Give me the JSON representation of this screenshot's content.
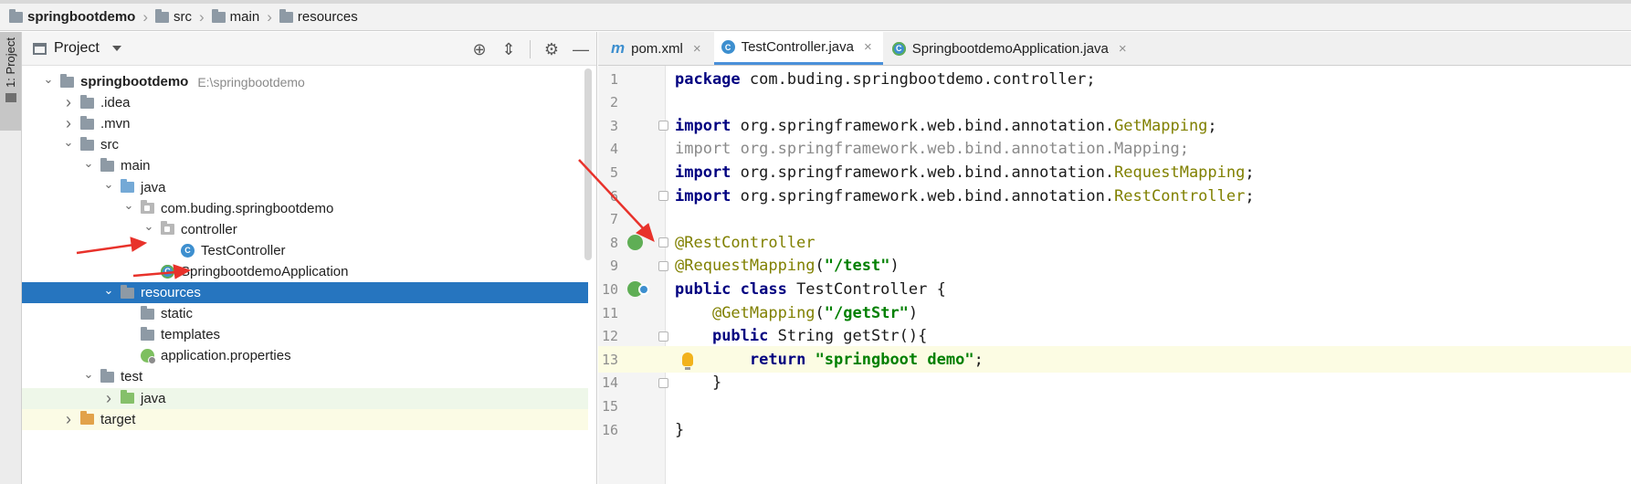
{
  "breadcrumb": {
    "items": [
      {
        "label": "springbootdemo",
        "icon": "folder-icon"
      },
      {
        "label": "src",
        "icon": "folder-icon"
      },
      {
        "label": "main",
        "icon": "folder-icon"
      },
      {
        "label": "resources",
        "icon": "resources-folder-icon"
      }
    ]
  },
  "sidebar": {
    "project_tab_label": "1: Project"
  },
  "project_panel": {
    "title": "Project",
    "tools": [
      "locate-icon",
      "collapse-icon",
      "gear-icon",
      "minimize-icon"
    ],
    "tree": [
      {
        "label": "springbootdemo",
        "path": "E:\\springbootdemo",
        "depth": 0,
        "expanded": true,
        "icon": "module-folder",
        "bold": true
      },
      {
        "label": ".idea",
        "depth": 1,
        "expanded": false,
        "icon": "folder"
      },
      {
        "label": ".mvn",
        "depth": 1,
        "expanded": false,
        "icon": "folder"
      },
      {
        "label": "src",
        "depth": 1,
        "expanded": true,
        "icon": "folder"
      },
      {
        "label": "main",
        "depth": 2,
        "expanded": true,
        "icon": "folder"
      },
      {
        "label": "java",
        "depth": 3,
        "expanded": true,
        "icon": "source-folder"
      },
      {
        "label": "com.buding.springbootdemo",
        "depth": 4,
        "expanded": true,
        "icon": "package"
      },
      {
        "label": "controller",
        "depth": 5,
        "expanded": true,
        "icon": "package"
      },
      {
        "label": "TestController",
        "depth": 6,
        "icon": "class"
      },
      {
        "label": "SpringbootdemoApplication",
        "depth": 5,
        "icon": "app-class"
      },
      {
        "label": "resources",
        "depth": 3,
        "expanded": true,
        "icon": "resources-folder",
        "selected": true
      },
      {
        "label": "static",
        "depth": 4,
        "icon": "folder"
      },
      {
        "label": "templates",
        "depth": 4,
        "icon": "folder"
      },
      {
        "label": "application.properties",
        "depth": 4,
        "icon": "properties"
      },
      {
        "label": "test",
        "depth": 2,
        "expanded": true,
        "icon": "folder"
      },
      {
        "label": "java",
        "depth": 3,
        "expanded": false,
        "icon": "test-folder",
        "highlight": "green"
      },
      {
        "label": "target",
        "depth": 1,
        "expanded": false,
        "icon": "excluded-folder",
        "highlight": "yellow"
      }
    ]
  },
  "editor": {
    "tabs": [
      {
        "label": "pom.xml",
        "icon": "maven-icon",
        "active": false
      },
      {
        "label": "TestController.java",
        "icon": "class-icon",
        "active": true
      },
      {
        "label": "SpringbootdemoApplication.java",
        "icon": "app-class-icon",
        "active": false
      }
    ],
    "current_line": 13,
    "lines": [
      {
        "n": "1",
        "tokens": [
          {
            "t": "package",
            "c": "kw"
          },
          {
            "t": " com.buding.springbootdemo.controller;",
            "c": ""
          }
        ]
      },
      {
        "n": "2",
        "tokens": []
      },
      {
        "n": "3",
        "tokens": [
          {
            "t": "import",
            "c": "kw"
          },
          {
            "t": " org.springframework.web.bind.annotation.",
            "c": ""
          },
          {
            "t": "GetMapping",
            "c": "ann"
          },
          {
            "t": ";",
            "c": ""
          }
        ],
        "fold": true
      },
      {
        "n": "4",
        "tokens": [
          {
            "t": "import",
            "c": "muted"
          },
          {
            "t": " org.springframework.web.bind.annotation.Mapping;",
            "c": "muted"
          }
        ]
      },
      {
        "n": "5",
        "tokens": [
          {
            "t": "import",
            "c": "kw"
          },
          {
            "t": " org.springframework.web.bind.annotation.",
            "c": ""
          },
          {
            "t": "RequestMapping",
            "c": "ann"
          },
          {
            "t": ";",
            "c": ""
          }
        ]
      },
      {
        "n": "6",
        "tokens": [
          {
            "t": "import",
            "c": "kw"
          },
          {
            "t": " org.springframework.web.bind.annotation.",
            "c": ""
          },
          {
            "t": "RestController",
            "c": "ann"
          },
          {
            "t": ";",
            "c": ""
          }
        ],
        "fold": true
      },
      {
        "n": "7",
        "tokens": []
      },
      {
        "n": "8",
        "tokens": [
          {
            "t": "@RestController",
            "c": "ann"
          }
        ],
        "fold": true,
        "gutter_icon": "spring-bean-icon"
      },
      {
        "n": "9",
        "tokens": [
          {
            "t": "@RequestMapping",
            "c": "ann"
          },
          {
            "t": "(",
            "c": ""
          },
          {
            "t": "\"/test\"",
            "c": "str"
          },
          {
            "t": ")",
            "c": ""
          }
        ],
        "fold": true
      },
      {
        "n": "10",
        "tokens": [
          {
            "t": "public class",
            "c": "kw"
          },
          {
            "t": " TestController {",
            "c": ""
          }
        ],
        "gutter_icon": "spring-bean-icon"
      },
      {
        "n": "11",
        "tokens": [
          {
            "t": "    ",
            "c": ""
          },
          {
            "t": "@GetMapping",
            "c": "ann"
          },
          {
            "t": "(",
            "c": ""
          },
          {
            "t": "\"/getStr\"",
            "c": "str"
          },
          {
            "t": ")",
            "c": ""
          }
        ]
      },
      {
        "n": "12",
        "tokens": [
          {
            "t": "    ",
            "c": ""
          },
          {
            "t": "public",
            "c": "kw"
          },
          {
            "t": " String getStr(){",
            "c": ""
          }
        ],
        "fold": true
      },
      {
        "n": "13",
        "tokens": [
          {
            "t": "        ",
            "c": ""
          },
          {
            "t": "return",
            "c": "kw"
          },
          {
            "t": " ",
            "c": ""
          },
          {
            "t": "\"springboot demo\"",
            "c": "str"
          },
          {
            "t": ";",
            "c": ""
          }
        ],
        "bulb": true
      },
      {
        "n": "14",
        "tokens": [
          {
            "t": "    }",
            "c": ""
          }
        ],
        "fold": true
      },
      {
        "n": "15",
        "tokens": []
      },
      {
        "n": "16",
        "tokens": [
          {
            "t": "}",
            "c": ""
          }
        ]
      }
    ]
  },
  "colors": {
    "selection": "#2675bf",
    "keyword": "#000080",
    "string": "#008000",
    "annotation": "#808000",
    "arrow": "#e8322b"
  }
}
